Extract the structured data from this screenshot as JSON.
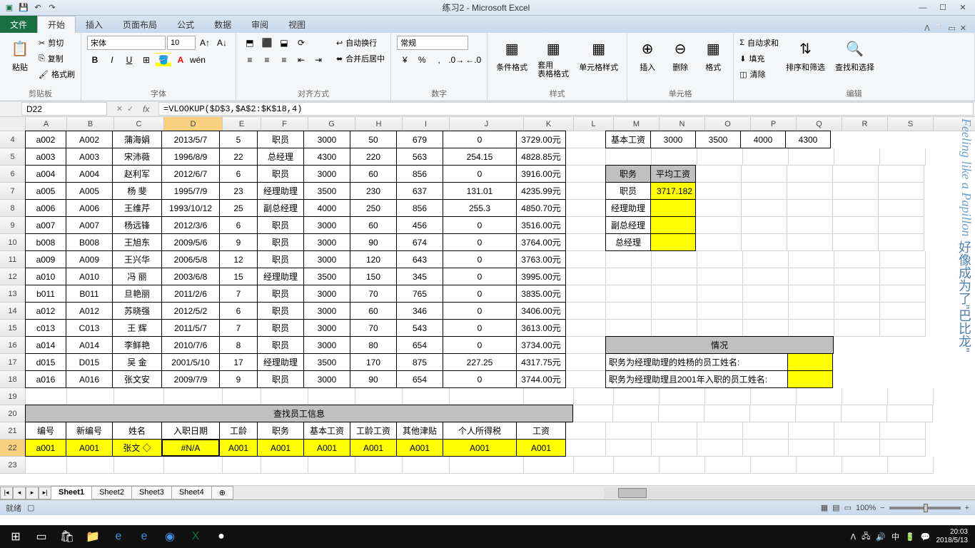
{
  "title": "练习2 - Microsoft Excel",
  "tabs": {
    "file": "文件",
    "home": "开始",
    "insert": "插入",
    "layout": "页面布局",
    "formula": "公式",
    "data": "数据",
    "review": "审阅",
    "view": "视图"
  },
  "ribbon": {
    "paste": "粘贴",
    "cut": "剪切",
    "copy": "复制",
    "format_painter": "格式刷",
    "clipboard": "剪贴板",
    "font_name": "宋体",
    "font_size": "10",
    "font_group": "字体",
    "wrap": "自动换行",
    "merge": "合并后居中",
    "align_group": "对齐方式",
    "num_format": "常规",
    "num_group": "数字",
    "cond": "条件格式",
    "table": "套用\n表格格式",
    "cellstyle": "单元格样式",
    "style_group": "样式",
    "ins": "插入",
    "del": "删除",
    "fmt": "格式",
    "cells_group": "单元格",
    "sum": "自动求和",
    "fill": "填充",
    "clear": "清除",
    "sort": "排序和筛选",
    "find": "查找和选择",
    "edit_group": "编辑"
  },
  "namebox": "D22",
  "formula": "=VLOOKUP($D$3,$A$2:$K$18,4)",
  "cols": [
    "A",
    "B",
    "C",
    "D",
    "E",
    "F",
    "G",
    "H",
    "I",
    "J",
    "K",
    "L",
    "M",
    "N",
    "O",
    "P",
    "Q",
    "R",
    "S"
  ],
  "rows_main": [
    {
      "n": 4,
      "d": [
        "a002",
        "A002",
        "蒲海娟",
        "2013/5/7",
        "5",
        "职员",
        "3000",
        "50",
        "679",
        "0",
        "3729.00元"
      ]
    },
    {
      "n": 5,
      "d": [
        "a003",
        "A003",
        "宋沛薇",
        "1996/8/9",
        "22",
        "总经理",
        "4300",
        "220",
        "563",
        "254.15",
        "4828.85元"
      ]
    },
    {
      "n": 6,
      "d": [
        "a004",
        "A004",
        "赵利军",
        "2012/6/7",
        "6",
        "职员",
        "3000",
        "60",
        "856",
        "0",
        "3916.00元"
      ]
    },
    {
      "n": 7,
      "d": [
        "a005",
        "A005",
        "杨 斐",
        "1995/7/9",
        "23",
        "经理助理",
        "3500",
        "230",
        "637",
        "131.01",
        "4235.99元"
      ]
    },
    {
      "n": 8,
      "d": [
        "a006",
        "A006",
        "王维芹",
        "1993/10/12",
        "25",
        "副总经理",
        "4000",
        "250",
        "856",
        "255.3",
        "4850.70元"
      ]
    },
    {
      "n": 9,
      "d": [
        "a007",
        "A007",
        "杨远锋",
        "2012/3/6",
        "6",
        "职员",
        "3000",
        "60",
        "456",
        "0",
        "3516.00元"
      ]
    },
    {
      "n": 10,
      "d": [
        "b008",
        "B008",
        "王旭东",
        "2009/5/6",
        "9",
        "职员",
        "3000",
        "90",
        "674",
        "0",
        "3764.00元"
      ]
    },
    {
      "n": 11,
      "d": [
        "a009",
        "A009",
        "王兴华",
        "2006/5/8",
        "12",
        "职员",
        "3000",
        "120",
        "643",
        "0",
        "3763.00元"
      ]
    },
    {
      "n": 12,
      "d": [
        "a010",
        "A010",
        "冯 丽",
        "2003/6/8",
        "15",
        "经理助理",
        "3500",
        "150",
        "345",
        "0",
        "3995.00元"
      ]
    },
    {
      "n": 13,
      "d": [
        "b011",
        "B011",
        "旦艳丽",
        "2011/2/6",
        "7",
        "职员",
        "3000",
        "70",
        "765",
        "0",
        "3835.00元"
      ]
    },
    {
      "n": 14,
      "d": [
        "a012",
        "A012",
        "苏晓强",
        "2012/5/2",
        "6",
        "职员",
        "3000",
        "60",
        "346",
        "0",
        "3406.00元"
      ]
    },
    {
      "n": 15,
      "d": [
        "c013",
        "C013",
        "王 辉",
        "2011/5/7",
        "7",
        "职员",
        "3000",
        "70",
        "543",
        "0",
        "3613.00元"
      ]
    },
    {
      "n": 16,
      "d": [
        "a014",
        "A014",
        "李鲜艳",
        "2010/7/6",
        "8",
        "职员",
        "3000",
        "80",
        "654",
        "0",
        "3734.00元"
      ]
    },
    {
      "n": 17,
      "d": [
        "d015",
        "D015",
        "吴 金",
        "2001/5/10",
        "17",
        "经理助理",
        "3500",
        "170",
        "875",
        "227.25",
        "4317.75元"
      ]
    },
    {
      "n": 18,
      "d": [
        "a016",
        "A016",
        "张文安",
        "2009/7/9",
        "9",
        "职员",
        "3000",
        "90",
        "654",
        "0",
        "3744.00元"
      ]
    }
  ],
  "side": {
    "base_label": "基本工资",
    "base": [
      "3000",
      "3500",
      "4000",
      "4300"
    ],
    "pos_label": "职务",
    "avg_label": "平均工资",
    "positions": [
      "职员",
      "经理助理",
      "副总经理",
      "总经理"
    ],
    "avg_val": "3717.182",
    "qk": "情况",
    "q1": "职务为经理助理的姓杨的员工姓名:",
    "q2": "职务为经理助理且2001年入职的员工姓名:"
  },
  "lookup": {
    "title": "查找员工信息",
    "hdr": [
      "编号",
      "新编号",
      "姓名",
      "入职日期",
      "工龄",
      "职务",
      "基本工资",
      "工龄工资",
      "其他津贴",
      "个人所得税",
      "工资"
    ],
    "row": [
      "a001",
      "A001",
      "张文",
      "#N/A",
      "A001",
      "A001",
      "A001",
      "A001",
      "A001",
      "A001",
      "A001"
    ]
  },
  "sheets": [
    "Sheet1",
    "Sheet2",
    "Sheet3",
    "Sheet4"
  ],
  "status": {
    "ready": "就绪",
    "zoom": "100%"
  },
  "clock": {
    "time": "20:03",
    "date": "2018/5/13"
  },
  "watermark": {
    "cn": "好像成为了\"巴比龙\"",
    "en": "Feeling like a Papillon"
  }
}
